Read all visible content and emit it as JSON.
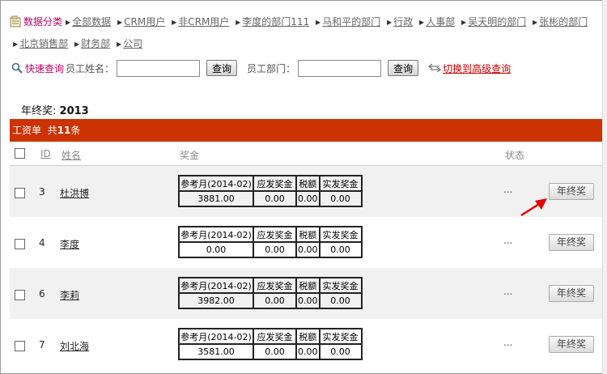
{
  "categories": {
    "title": "数据分类",
    "items": [
      "全部数据",
      "CRM用户",
      "非CRM用户",
      "李度的部门111",
      "马和平的部门",
      "行政",
      "人事部",
      "吴天明的部门",
      "张彬的部门",
      "北京销售部",
      "财务部",
      "公司"
    ]
  },
  "search": {
    "quick_label": "快速查询",
    "name_label": "员工姓名：",
    "name_value": "",
    "dept_label": "员工部门：",
    "dept_value": "",
    "query_btn": "查询",
    "advanced_link": "切换到高级查询"
  },
  "page_title": {
    "label": "年终奖:",
    "year": "2013"
  },
  "list_header": {
    "prefix": "工资单  共",
    "count": "11",
    "suffix": "条"
  },
  "columns": {
    "id": "ID",
    "name": "姓名",
    "bonus": "奖金",
    "status": "状态"
  },
  "bonus_headers": [
    "参考月(2014-02)",
    "应发奖金",
    "税额",
    "实发奖金"
  ],
  "rows": [
    {
      "id": "3",
      "name": "杜洪博",
      "ref": "3881.00",
      "due": "0.00",
      "tax": "0.00",
      "paid": "0.00",
      "status": "...",
      "action": "年终奖"
    },
    {
      "id": "4",
      "name": "李度",
      "ref": "0.00",
      "due": "0.00",
      "tax": "0.00",
      "paid": "0.00",
      "status": "...",
      "action": "年终奖"
    },
    {
      "id": "6",
      "name": "李莉",
      "ref": "3982.00",
      "due": "0.00",
      "tax": "0.00",
      "paid": "0.00",
      "status": "...",
      "action": "年终奖"
    },
    {
      "id": "7",
      "name": "刘北海",
      "ref": "3581.00",
      "due": "0.00",
      "tax": "0.00",
      "paid": "0.00",
      "status": "...",
      "action": "年终奖"
    }
  ],
  "colors": {
    "accent": "#cc3300",
    "link_magenta": "#c0006b",
    "link_red": "#cc0000",
    "annotation_arrow": "#e60000"
  }
}
